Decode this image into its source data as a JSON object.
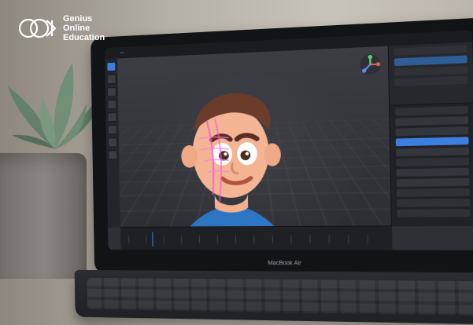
{
  "brand": {
    "line1": "Genius",
    "line2": "Online",
    "line3": "Education"
  },
  "laptop": {
    "model_label": "MacBook Air"
  }
}
